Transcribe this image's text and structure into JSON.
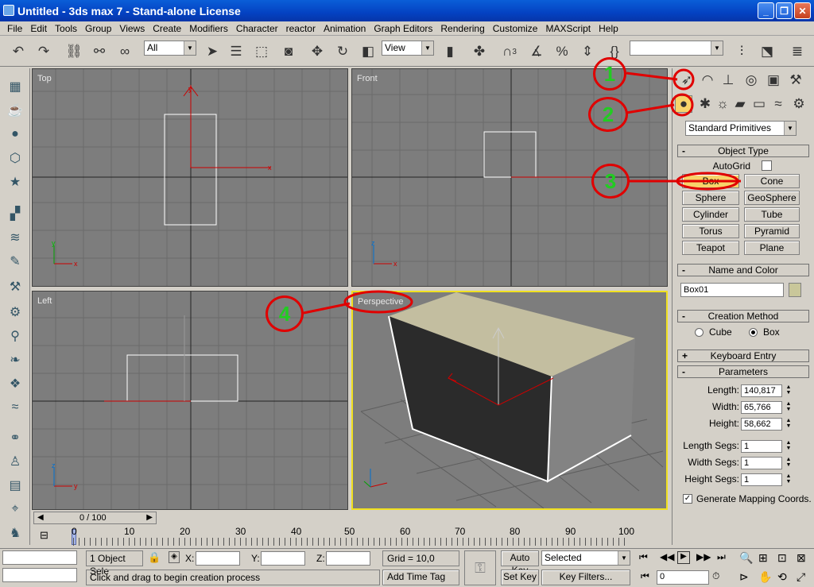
{
  "title": "Untitled - 3ds max 7   - Stand-alone License",
  "menu": [
    "File",
    "Edit",
    "Tools",
    "Group",
    "Views",
    "Create",
    "Modifiers",
    "Character",
    "reactor",
    "Animation",
    "Graph Editors",
    "Rendering",
    "Customize",
    "MAXScript",
    "Help"
  ],
  "toolbar": {
    "selection_filter": "All",
    "ref_coord": "View",
    "snap_label": "3"
  },
  "viewports": {
    "top": "Top",
    "front": "Front",
    "left": "Left",
    "perspective": "Perspective"
  },
  "panel": {
    "category_dropdown": "Standard Primitives",
    "object_type_header": "Object Type",
    "autogrid_label": "AutoGrid",
    "buttons": [
      [
        "Box",
        "Cone"
      ],
      [
        "Sphere",
        "GeoSphere"
      ],
      [
        "Cylinder",
        "Tube"
      ],
      [
        "Torus",
        "Pyramid"
      ],
      [
        "Teapot",
        "Plane"
      ]
    ],
    "name_color_header": "Name and Color",
    "object_name": "Box01",
    "creation_header": "Creation Method",
    "creation_options": [
      "Cube",
      "Box"
    ],
    "keyboard_header": "Keyboard Entry",
    "params_header": "Parameters",
    "length_label": "Length:",
    "length": "140,817",
    "width_label": "Width:",
    "width": "65,766",
    "height_label": "Height:",
    "height": "58,662",
    "lsegs_label": "Length Segs:",
    "lsegs": "1",
    "wsegs_label": "Width Segs:",
    "wsegs": "1",
    "hsegs_label": "Height Segs:",
    "hsegs": "1",
    "mapping_label": "Generate Mapping Coords.",
    "collapse": "-",
    "expand": "+"
  },
  "timeline": {
    "slider": "0 / 100",
    "ticks": [
      "0",
      "10",
      "20",
      "30",
      "40",
      "50",
      "60",
      "70",
      "80",
      "90",
      "100"
    ]
  },
  "status": {
    "selected": "1 Object Sele",
    "x_label": "X:",
    "y_label": "Y:",
    "z_label": "Z:",
    "grid": "Grid = 10,0",
    "prompt": "Click and drag to begin creation process",
    "add_time_tag": "Add Time Tag",
    "auto_key": "Auto Key",
    "set_key": "Set Key",
    "key_mode": "Selected",
    "key_filters": "Key Filters...",
    "frame": "0"
  },
  "annotations": [
    "1",
    "2",
    "3",
    "4"
  ],
  "colors": {
    "accent_red": "#e00000",
    "annotation_green": "#22cc22",
    "active_yellow": "#f7d36a",
    "viewport_gray": "#7d7d7d"
  }
}
